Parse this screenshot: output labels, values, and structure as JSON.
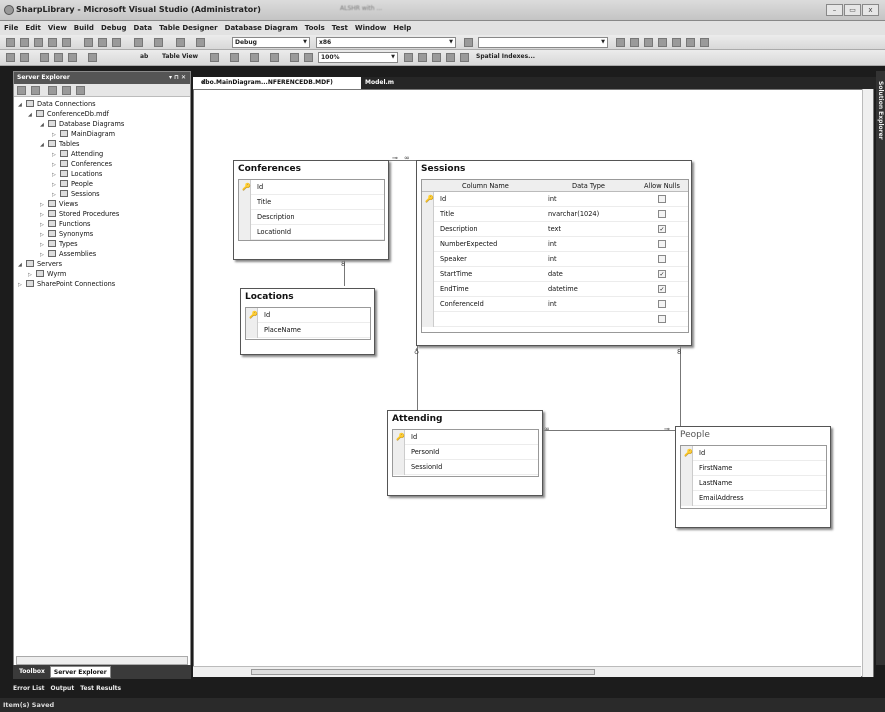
{
  "window": {
    "title": "SharpLibrary - Microsoft Visual Studio (Administrator)",
    "blurred_text": "ALSHR with ..."
  },
  "menu": [
    "File",
    "Edit",
    "View",
    "Build",
    "Debug",
    "Data",
    "Table Designer",
    "Database Diagram",
    "Tools",
    "Test",
    "Window",
    "Help"
  ],
  "toolbar": {
    "config": "Debug",
    "platform": "x86",
    "view_label": "Table View",
    "zoom": "100%",
    "spatial": "Spatial Indexes..."
  },
  "server_explorer": {
    "title": "Server Explorer",
    "pin": "▾ ⊓ ✕",
    "tree": [
      {
        "label": "Data Connections"
      },
      {
        "label": "ConferenceDb.mdf"
      },
      {
        "label": "Database Diagrams"
      },
      {
        "label": "MainDiagram"
      },
      {
        "label": "Tables"
      },
      {
        "label": "Attending"
      },
      {
        "label": "Conferences"
      },
      {
        "label": "Locations"
      },
      {
        "label": "People"
      },
      {
        "label": "Sessions"
      },
      {
        "label": "Views"
      },
      {
        "label": "Stored Procedures"
      },
      {
        "label": "Functions"
      },
      {
        "label": "Synonyms"
      },
      {
        "label": "Types"
      },
      {
        "label": "Assemblies"
      },
      {
        "label": "Servers"
      },
      {
        "label": "Wyrm"
      },
      {
        "label": "SharePoint Connections"
      }
    ],
    "bottom_tabs": [
      "Toolbox",
      "Server Explorer"
    ]
  },
  "bottom_panels": [
    "Error List",
    "Output",
    "Test Results"
  ],
  "status": "Item(s) Saved",
  "doc_tabs": [
    {
      "label": "dbo.MainDiagram...NFERENCEDB.MDF)"
    },
    {
      "label": "Model.m"
    }
  ],
  "close_glyph": "✕",
  "side_label": "Solution Explorer",
  "tables": {
    "conferences": {
      "name": "Conferences",
      "columns": [
        "Id",
        "Title",
        "Description",
        "LocationId"
      ]
    },
    "locations": {
      "name": "Locations",
      "columns": [
        "Id",
        "PlaceName"
      ]
    },
    "sessions": {
      "name": "Sessions",
      "headers": [
        "Column Name",
        "Data Type",
        "Allow Nulls"
      ],
      "rows": [
        {
          "col": "Id",
          "type": "int",
          "nulls": false
        },
        {
          "col": "Title",
          "type": "nvarchar(1024)",
          "nulls": false
        },
        {
          "col": "Description",
          "type": "text",
          "nulls": true
        },
        {
          "col": "NumberExpected",
          "type": "int",
          "nulls": false
        },
        {
          "col": "Speaker",
          "type": "int",
          "nulls": false
        },
        {
          "col": "StartTime",
          "type": "date",
          "nulls": true
        },
        {
          "col": "EndTime",
          "type": "datetime",
          "nulls": true
        },
        {
          "col": "ConferenceId",
          "type": "int",
          "nulls": false
        },
        {
          "col": "",
          "type": "",
          "nulls": false
        }
      ]
    },
    "attending": {
      "name": "Attending",
      "columns": [
        "Id",
        "PersonId",
        "SessionId"
      ]
    },
    "people": {
      "name": "People",
      "columns": [
        "Id",
        "FirstName",
        "LastName",
        "EmailAddress"
      ]
    }
  },
  "key_glyph": "🔑",
  "check_glyph": "✓",
  "colors": {
    "accent": "#555555",
    "canvas": "#ffffff"
  }
}
